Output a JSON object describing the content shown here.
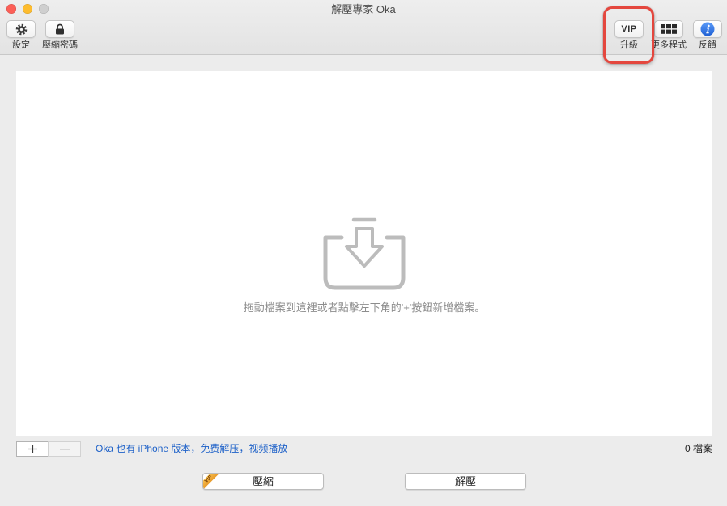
{
  "window": {
    "title": "解壓專家 Oka"
  },
  "toolbar": {
    "items": [
      {
        "icon": "gear-icon",
        "label": "設定"
      },
      {
        "icon": "lock-icon",
        "label": "壓縮密碼"
      },
      {
        "icon": "vip-badge",
        "text": "VIP",
        "label": "升級"
      },
      {
        "icon": "grid-icon",
        "label": "更多程式"
      },
      {
        "icon": "info-icon",
        "label": "反饋"
      }
    ]
  },
  "drop_zone": {
    "icon": "inbox-download-icon",
    "hint": "拖動檔案到這裡或者點擊左下角的'+'按鈕新增檔案。"
  },
  "file_controls": {
    "add_icon": "plus-icon",
    "remove_icon": "minus-icon",
    "remove_enabled": false
  },
  "promo_link": {
    "text": "Oka 也有 iPhone 版本，免费解压，视频播放"
  },
  "file_count": "0 檔案",
  "actions": {
    "compress": {
      "label": "壓縮",
      "badge": "VIP"
    },
    "extract": {
      "label": "解壓"
    }
  },
  "colors": {
    "window_bg": "#ececec",
    "close": "#fc5f57",
    "minimize": "#fdbc2e",
    "zoom": "#cfcfcf",
    "link": "#1c60c8",
    "hint": "#8d8d8d",
    "drop_icon": "#bcbcbc",
    "highlight": "#e4473e",
    "info": "#2d6fe0",
    "vip_ribbon": "#e89a2a"
  }
}
